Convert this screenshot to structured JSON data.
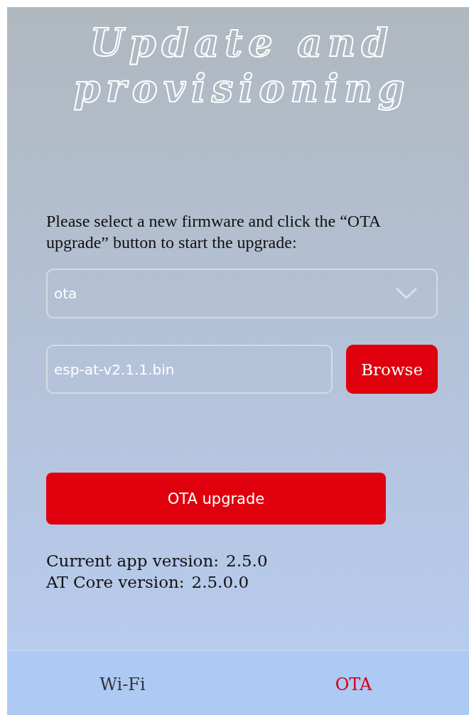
{
  "title": "Update and provisioning",
  "instructions": "Please select a new firmware and click the “OTA upgrade” button to start the upgrade:",
  "select": {
    "value": "ota"
  },
  "file_field": {
    "value": "esp-at-v2.1.1.bin"
  },
  "browse_button": "Browse",
  "upgrade_button": "OTA upgrade",
  "versions": [
    {
      "label": "Current app version:",
      "value": "2.5.0"
    },
    {
      "label": "AT Core version:",
      "value": "2.5.0.0"
    }
  ],
  "tabs": [
    {
      "label": "Wi-Fi",
      "selected": false
    },
    {
      "label": "OTA",
      "selected": true
    }
  ]
}
